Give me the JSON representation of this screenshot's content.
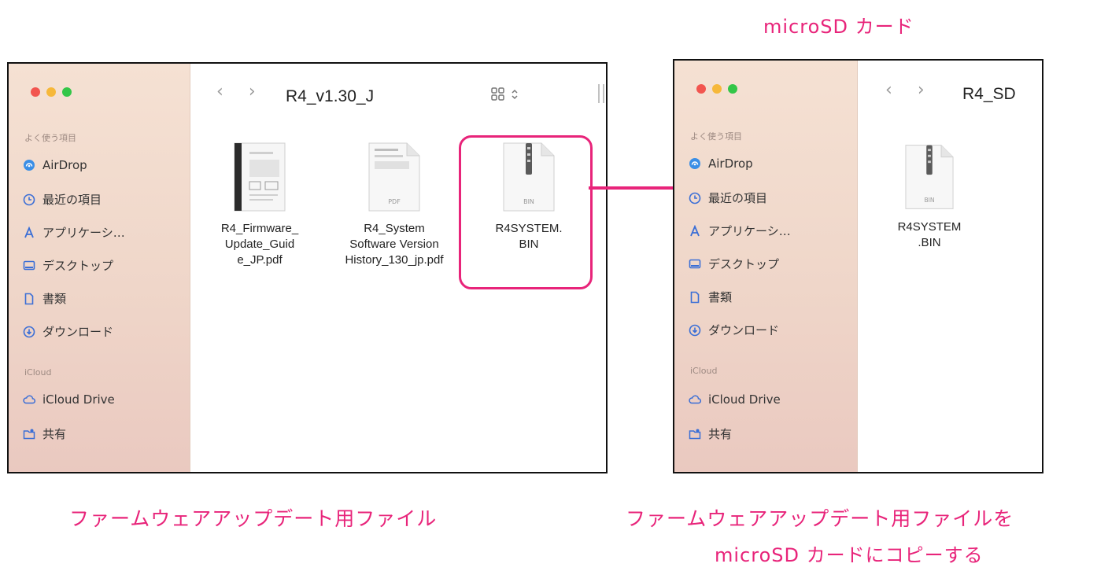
{
  "captions": {
    "top_right": "microSD カード",
    "left": "ファームウェアアップデート用ファイル",
    "right_line1": "ファームウェアアップデート用ファイルを",
    "right_line2": "microSD カードにコピーする"
  },
  "colors": {
    "accent": "#e8247a",
    "sidebar_top": "#f5e1d3",
    "sidebar_bottom": "#eac9c0",
    "traffic_red": "#f2554f",
    "traffic_yellow": "#f6b83a",
    "traffic_green": "#33c648"
  },
  "sidebar": {
    "favorites_header": "よく使う項目",
    "items": [
      {
        "label": "AirDrop",
        "icon": "airdrop-icon"
      },
      {
        "label": "最近の項目",
        "icon": "clock-icon"
      },
      {
        "label": "アプリケーシ…",
        "icon": "applications-icon"
      },
      {
        "label": "デスクトップ",
        "icon": "desktop-icon"
      },
      {
        "label": "書類",
        "icon": "document-icon"
      },
      {
        "label": "ダウンロード",
        "icon": "download-icon"
      }
    ],
    "icloud_header": "iCloud",
    "icloud_items": [
      {
        "label": "iCloud Drive",
        "icon": "cloud-icon"
      },
      {
        "label": "共有",
        "icon": "shared-folder-icon"
      }
    ]
  },
  "left_window": {
    "title": "R4_v1.30_J",
    "files": [
      {
        "name": "R4_Firmware_\nUpdate_Guid\ne_JP.pdf",
        "icon": "pdf-preview-icon"
      },
      {
        "name": "R4_System\nSoftware Version\nHistory_130_jp.pdf",
        "icon": "pdf-file-icon",
        "badge": "PDF"
      },
      {
        "name": "R4SYSTEM.\nBIN",
        "icon": "bin-file-icon",
        "badge": "BIN",
        "highlighted": true
      }
    ]
  },
  "right_window": {
    "title": "R4_SD",
    "files": [
      {
        "name": "R4SYSTEM\n.BIN",
        "icon": "bin-file-icon",
        "badge": "BIN"
      }
    ]
  }
}
